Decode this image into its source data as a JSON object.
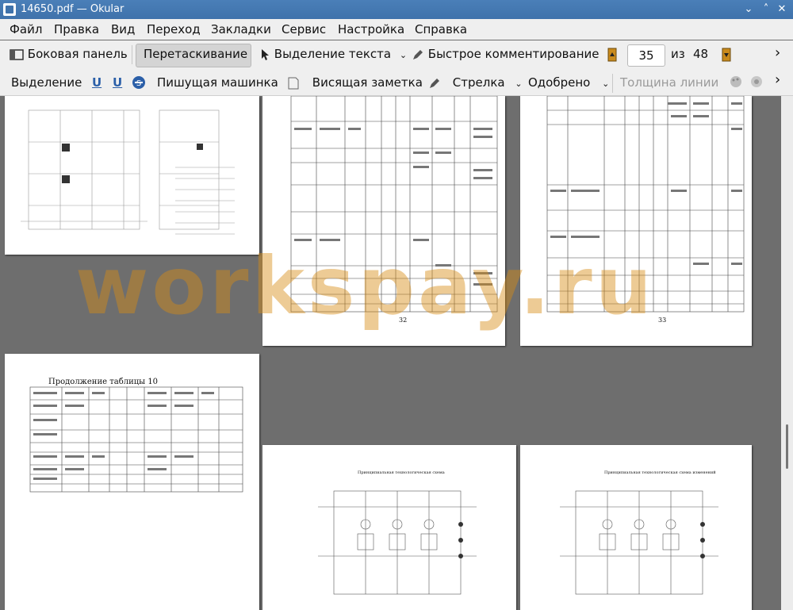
{
  "window": {
    "title": "14650.pdf — Okular",
    "controls": [
      "⌄",
      "˄",
      "✕"
    ]
  },
  "menu": [
    "Файл",
    "Правка",
    "Вид",
    "Переход",
    "Закладки",
    "Сервис",
    "Настройка",
    "Справка"
  ],
  "toolbar1": {
    "sidebar": "Боковая панель",
    "drag": "Перетаскивание",
    "text_select": "Выделение текста",
    "quick_comment": "Быстрое комментирование",
    "page_current": "35",
    "page_of": "из",
    "page_total": "48",
    "more": "›"
  },
  "toolbar2": {
    "highlight": "Выделение",
    "typewriter": "Пишущая машинка",
    "note": "Висящая заметка",
    "arrow": "Стрелка",
    "stamp": "Одобрено",
    "line_width": "Толщина линии",
    "more": "›"
  },
  "pages": {
    "table_title": "Продолжение таблицы 10",
    "page32_number": "32",
    "page33_number": "33",
    "scheme1_title": "Принципиальная технологическая схема",
    "scheme2_title": "Принципиальная технологическая схема изменений"
  },
  "watermark": "workspay.ru"
}
